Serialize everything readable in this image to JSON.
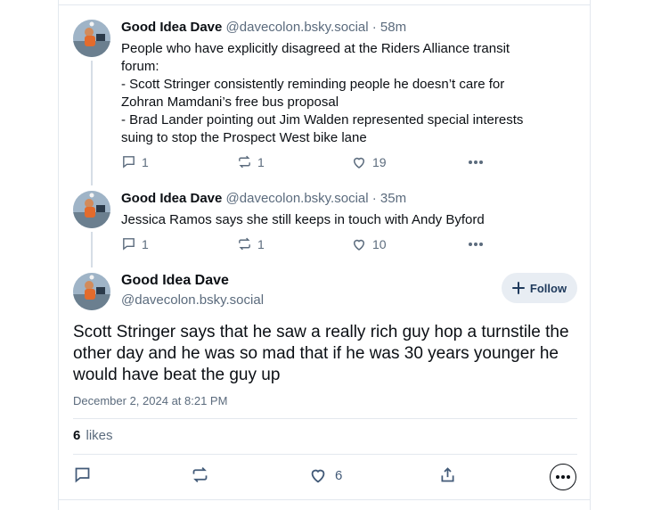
{
  "replies": [
    {
      "name": "Good Idea Dave",
      "handle": "@davecolon.bsky.social",
      "separator": "·",
      "time": "58m",
      "text": "People who have explicitly disagreed at the Riders Alliance transit\nforum:\n- Scott Stringer consistently reminding people he doesn’t care for\nZohran Mamdani’s free bus proposal\n- Brad Lander pointing out Jim Walden represented special interests\nsuing to stop the Prospect West bike lane",
      "reply_count": "1",
      "repost_count": "1",
      "like_count": "19"
    },
    {
      "name": "Good Idea Dave",
      "handle": "@davecolon.bsky.social",
      "separator": "·",
      "time": "35m",
      "text": "Jessica Ramos says she still keeps in touch with Andy Byford",
      "reply_count": "1",
      "repost_count": "1",
      "like_count": "10"
    }
  ],
  "main_post": {
    "name": "Good Idea Dave",
    "handle": "@davecolon.bsky.social",
    "follow_label": "Follow",
    "text": "Scott Stringer says that he saw a really rich guy hop a turnstile the other day and he was so mad that if he was 30 years younger he would have beat the guy up",
    "date": "December 2, 2024 at 8:21 PM",
    "likes_count": "6",
    "likes_label": "likes",
    "like_action_count": "6"
  },
  "icons": {
    "reply": "comment-icon",
    "repost": "repost-icon",
    "like": "heart-icon",
    "share": "share-icon",
    "more": "more-dots-icon",
    "follow": "plus-icon"
  },
  "colors": {
    "text": "#0b0f14",
    "muted": "#5b6b7d",
    "follow_bg": "#e8edf3",
    "divider": "#e3e8ee"
  }
}
